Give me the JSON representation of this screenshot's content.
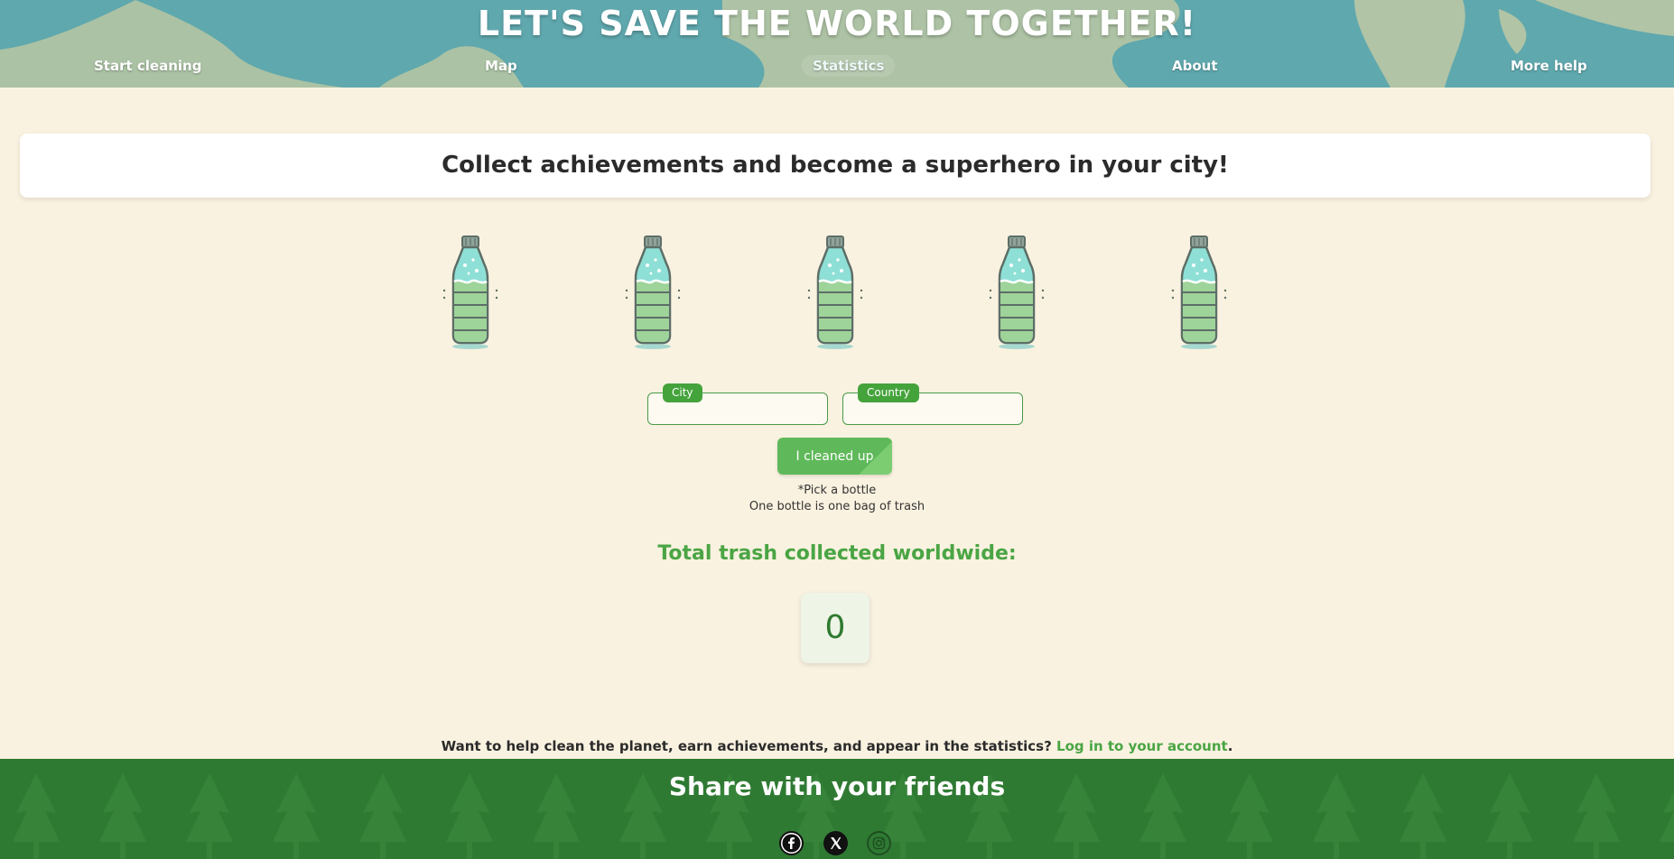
{
  "header": {
    "title": "LET'S SAVE THE WORLD TOGETHER!",
    "nav": [
      {
        "label": "Start cleaning",
        "active": false
      },
      {
        "label": "Map",
        "active": false
      },
      {
        "label": "Statistics",
        "active": true
      },
      {
        "label": "About",
        "active": false
      },
      {
        "label": "More help",
        "active": false
      }
    ]
  },
  "banner": {
    "text": "Collect achievements and become a superhero in your city!"
  },
  "bottles": {
    "count": 5,
    "icon": "bottle-icon"
  },
  "form": {
    "city_label": "City",
    "city_value": "",
    "country_label": "Country",
    "country_value": "",
    "submit_label": "I cleaned up"
  },
  "hints": {
    "pick": "*Pick a bottle",
    "unit": "One bottle is one bag of trash"
  },
  "stats": {
    "title": "Total trash collected worldwide:",
    "total": "0"
  },
  "login": {
    "prompt": "Want to help clean the planet, earn achievements, and appear in the statistics?",
    "link_label": "Log in to your account",
    "suffix": "."
  },
  "footer": {
    "title": "Share with your friends",
    "social": [
      "facebook-icon",
      "x-icon",
      "instagram-icon"
    ]
  },
  "colors": {
    "background": "#faf2e0",
    "header_sea": "#5fa8ae",
    "accent_green": "#4aa544",
    "footer_green": "#2f7a33"
  }
}
